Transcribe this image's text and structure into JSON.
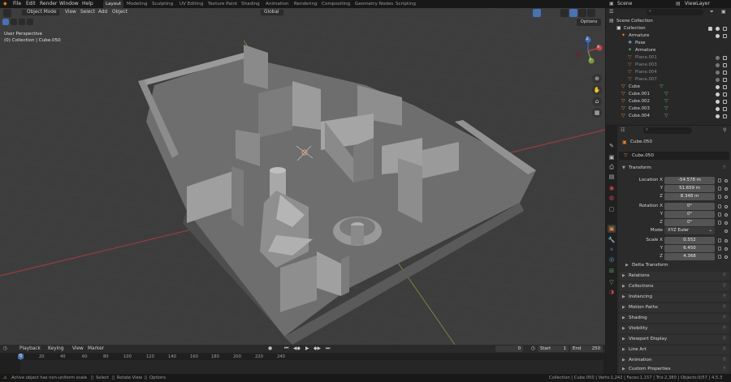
{
  "menu": {
    "app_icon": "blender-logo-icon",
    "file": "File",
    "edit": "Edit",
    "render": "Render",
    "window": "Window",
    "help": "Help"
  },
  "workspaces": [
    "Layout",
    "Modeling",
    "Sculpting",
    "UV Editing",
    "Texture Paint",
    "Shading",
    "Animation",
    "Rendering",
    "Compositing",
    "Geometry Nodes",
    "Scripting"
  ],
  "scene": {
    "label": "Scene",
    "view_layer": "ViewLayer"
  },
  "viewport": {
    "mode": "Object Mode",
    "menu_view": "View",
    "menu_select": "Select",
    "menu_add": "Add",
    "menu_object": "Object",
    "orientation": "Global",
    "options_label": "Options",
    "info_line1": "User Perspective",
    "info_line2": "(0) Collection | Cube.050",
    "gizmo_x": "X",
    "gizmo_y": "Y",
    "gizmo_z": "Z"
  },
  "outliner": {
    "search_placeholder": "",
    "rows": [
      {
        "label": "Scene Collection",
        "indent": 0,
        "icon": "scene-collection-icon"
      },
      {
        "label": "Collection",
        "indent": 1,
        "icon": "collection-icon"
      },
      {
        "label": "Armature",
        "indent": 2,
        "icon": "armature-icon"
      },
      {
        "label": "Pose",
        "indent": 3,
        "icon": "pose-icon"
      },
      {
        "label": "Armature",
        "indent": 3,
        "icon": "armature-data-icon"
      },
      {
        "label": "Plane.001",
        "indent": 3,
        "icon": "mesh-icon",
        "dim": true
      },
      {
        "label": "Plane.003",
        "indent": 3,
        "icon": "mesh-icon",
        "dim": true
      },
      {
        "label": "Plane.004",
        "indent": 3,
        "icon": "mesh-icon",
        "dim": true
      },
      {
        "label": "Plane.007",
        "indent": 3,
        "icon": "mesh-icon",
        "dim": true
      },
      {
        "label": "Cube",
        "indent": 2,
        "icon": "mesh-icon"
      },
      {
        "label": "Cube.001",
        "indent": 2,
        "icon": "mesh-icon"
      },
      {
        "label": "Cube.002",
        "indent": 2,
        "icon": "mesh-icon"
      },
      {
        "label": "Cube.003",
        "indent": 2,
        "icon": "mesh-icon"
      },
      {
        "label": "Cube.004",
        "indent": 2,
        "icon": "mesh-icon"
      }
    ]
  },
  "properties": {
    "object_name": "Cube.050",
    "data_name": "Cube.050",
    "transform_label": "Transform",
    "location_label": "Location X",
    "loc_x": "-54.578 m",
    "loc_y": "51.659 m",
    "loc_z": "8.348 m",
    "rotation_label": "Rotation X",
    "rot_x": "0°",
    "rot_y": "0°",
    "rot_z": "0°",
    "mode_label": "Mode",
    "mode_value": "XYZ Euler",
    "scale_label": "Scale X",
    "scale_x": "0.552",
    "scale_y": "6.450",
    "scale_z": "4.368",
    "y_label": "Y",
    "z_label": "Z",
    "delta_label": "Delta Transform",
    "panels": [
      "Relations",
      "Collections",
      "Instancing",
      "Motion Paths",
      "Shading",
      "Visibility",
      "Viewport Display",
      "Line Art",
      "Animation",
      "Custom Properties"
    ]
  },
  "timeline": {
    "playback": "Playback",
    "keying": "Keying",
    "view": "View",
    "marker": "Marker",
    "current_frame": "0",
    "start_label": "Start",
    "start": "1",
    "end_label": "End",
    "end": "250",
    "ticks": [
      "0",
      "20",
      "40",
      "60",
      "80",
      "100",
      "120",
      "140",
      "160",
      "180",
      "200",
      "220",
      "240"
    ]
  },
  "status": {
    "warning": "Active object has non-uniform scale",
    "select": "Select",
    "rotate": "Rotate View",
    "options": "Options",
    "stats": "Collection | Cube.050 | Verts:1,242 | Faces:1,157 | Tris:2,380 | Objects:0/57 | 4.5.3"
  },
  "colors": {
    "accent": "#4772b3",
    "selected_row": "#334d80",
    "x_axis": "#c9404a",
    "y_axis": "#7a9a3a"
  }
}
